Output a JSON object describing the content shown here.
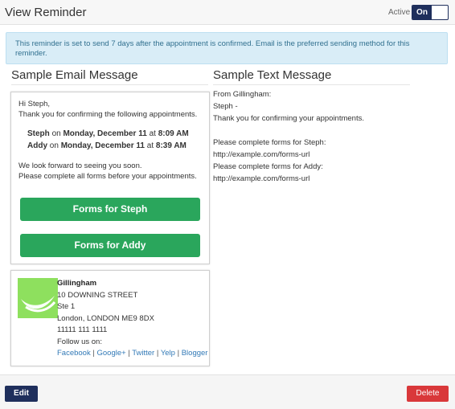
{
  "header": {
    "title": "View Reminder",
    "active_label": "Active",
    "toggle_label": "On"
  },
  "info": {
    "text": "This reminder is set to send 7 days after the appointment is confirmed. Email is the preferred sending method for this reminder."
  },
  "email": {
    "section_title": "Sample Email Message",
    "greeting": "Hi Steph,",
    "intro": "Thank you for confirming the following appointments.",
    "appointments": [
      {
        "name": "Steph",
        "on": "on",
        "date": "Monday, December 11",
        "at": "at",
        "time": "8:09 AM"
      },
      {
        "name": "Addy",
        "on": "on",
        "date": "Monday, December 11",
        "at": "at",
        "time": "8:39 AM"
      }
    ],
    "closing_1": "We look forward to seeing you soon.",
    "closing_2": "Please complete all forms before your appointments.",
    "buttons": [
      "Forms for Steph",
      "Forms for Addy"
    ],
    "accent_color": "#2aa65c"
  },
  "signature": {
    "name": "Gillingham",
    "street": "10 DOWNING STREET",
    "suite": "Ste 1",
    "city": "London, LONDON ME9 8DX",
    "phone": "11111 111 1111",
    "follow": "Follow us on:",
    "links": [
      "Facebook",
      "Google+",
      "Twitter",
      "Yelp",
      "Blogger"
    ],
    "separator": "|",
    "logo_color": "#8ee05e"
  },
  "sms": {
    "section_title": "Sample Text Message",
    "lines": [
      "From Gillingham:",
      "Steph -",
      "Thank you for confirming your appointments.",
      "",
      "Please complete forms for Steph:",
      "http://example.com/forms-url",
      "Please complete forms for Addy:",
      "http://example.com/forms-url"
    ]
  },
  "footer": {
    "edit_label": "Edit",
    "delete_label": "Delete",
    "primary_color": "#1f2f5c",
    "danger_color": "#d9383a"
  }
}
